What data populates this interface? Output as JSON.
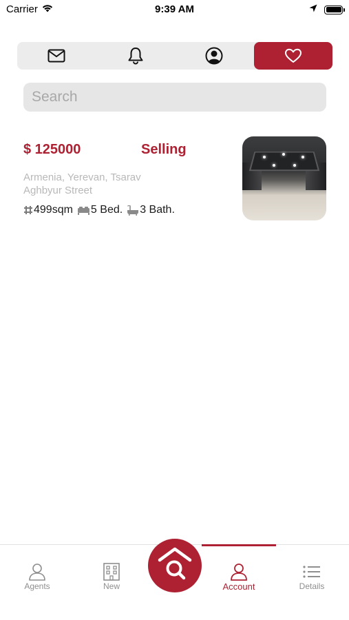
{
  "status_bar": {
    "carrier": "Carrier",
    "time": "9:39 AM"
  },
  "top_tabs": [
    {
      "icon": "mail-icon",
      "active": false
    },
    {
      "icon": "bell-icon",
      "active": false
    },
    {
      "icon": "user-circle-icon",
      "active": false
    },
    {
      "icon": "heart-icon",
      "active": true
    }
  ],
  "search": {
    "placeholder": "Search",
    "value": ""
  },
  "listing": {
    "price": "$ 125000",
    "status": "Selling",
    "address": "Armenia, Yerevan, Tsarav Aghbyur Street",
    "area": "499sqm",
    "beds": "5 Bed.",
    "baths": "3 Bath."
  },
  "tabbar": {
    "items": [
      {
        "label": "Agents",
        "icon": "agent-icon",
        "active": false
      },
      {
        "label": "New",
        "icon": "building-icon",
        "active": false
      },
      {
        "label": "Account",
        "icon": "account-icon",
        "active": true
      },
      {
        "label": "Details",
        "icon": "list-icon",
        "active": false
      }
    ],
    "center_icon": "home-search-icon"
  },
  "colors": {
    "accent": "#ad2132",
    "segment_bg": "#ececec",
    "search_bg": "#e6e6e6",
    "muted": "#8e8e8e"
  }
}
